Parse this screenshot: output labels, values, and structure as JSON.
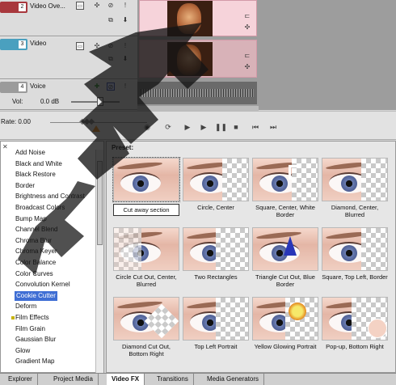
{
  "tracks": [
    {
      "number": "2",
      "name": "Video Ove...",
      "color": "#a8383d"
    },
    {
      "number": "3",
      "name": "Video",
      "color": "#4aa0bf"
    },
    {
      "number": "4",
      "name": "Voice",
      "color": "#9b9b9b",
      "vol_label": "Vol:",
      "vol_value": "0.0 dB"
    }
  ],
  "transport": {
    "rate_label": "Rate: 0.00"
  },
  "fx_list": {
    "items": [
      "Add Noise",
      "Black and White",
      "Black Restore",
      "Border",
      "Brightness and Contrast",
      "Broadcast Colors",
      "Bump Map",
      "Channel Blend",
      "Chroma Blur",
      "Chroma Keyer",
      "Color Balance",
      "Color Curves",
      "Convolution Kernel",
      "Cookie Cutter",
      "Deform",
      "Film Effects",
      "Film Grain",
      "Gaussian Blur",
      "Glow",
      "Gradient Map"
    ],
    "selected": "Cookie Cutter",
    "marked": "Film Effects"
  },
  "presets": {
    "title": "Preset:",
    "items": [
      {
        "label": "Cut away section"
      },
      {
        "label": "Circle, Center"
      },
      {
        "label": "Square, Center, White Border"
      },
      {
        "label": "Diamond, Center, Blurred"
      },
      {
        "label": "Circle Cut Out, Center, Blurred"
      },
      {
        "label": "Two Rectangles"
      },
      {
        "label": "Triangle Cut Out, Blue Border"
      },
      {
        "label": "Square, Top Left, Border"
      },
      {
        "label": "Diamond Cut Out, Bottom Right"
      },
      {
        "label": "Top Left Portrait"
      },
      {
        "label": "Yellow Glowing Portrait"
      },
      {
        "label": "Pop-up, Bottom Right"
      }
    ],
    "selected": "Cut away section"
  },
  "tabs": [
    {
      "label": "Explorer"
    },
    {
      "label": "Project Media"
    },
    {
      "label": "Video FX",
      "active": true
    },
    {
      "label": "Transitions"
    },
    {
      "label": "Media Generators"
    }
  ],
  "colors": {
    "selection": "#3f6ed4",
    "clip": "#f6d3da",
    "accent_orange": "#e3861d"
  }
}
